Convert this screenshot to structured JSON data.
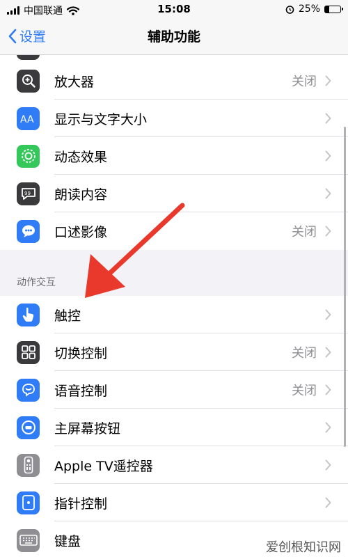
{
  "status_bar": {
    "carrier": "中国联通",
    "time": "15:08",
    "battery_percent": "25%",
    "battery_level": 0.25
  },
  "nav": {
    "back_label": "设置",
    "title": "辅助功能"
  },
  "vision_items": [
    {
      "label": "放大器",
      "value": "关闭",
      "icon": "magnifier-icon",
      "color": "#3a3a3c"
    },
    {
      "label": "显示与文字大小",
      "value": "",
      "icon": "text-size-icon",
      "color": "#2f7cf6"
    },
    {
      "label": "动态效果",
      "value": "",
      "icon": "motion-icon",
      "color": "#34c759"
    },
    {
      "label": "朗读内容",
      "value": "",
      "icon": "speech-bubble-icon",
      "color": "#3a3a3c"
    },
    {
      "label": "口述影像",
      "value": "关闭",
      "icon": "audio-description-icon",
      "color": "#2f7cf6"
    }
  ],
  "section_header": "动作交互",
  "interaction_items": [
    {
      "label": "触控",
      "value": "",
      "icon": "touch-hand-icon",
      "color": "#2f7cf6"
    },
    {
      "label": "切换控制",
      "value": "关闭",
      "icon": "switch-grid-icon",
      "color": "#3a3a3c"
    },
    {
      "label": "语音控制",
      "value": "关闭",
      "icon": "voice-control-icon",
      "color": "#2f7cf6"
    },
    {
      "label": "主屏幕按钮",
      "value": "",
      "icon": "home-button-icon",
      "color": "#2f7cf6"
    },
    {
      "label": "Apple TV遥控器",
      "value": "",
      "icon": "tv-remote-icon",
      "color": "#8e8e93"
    },
    {
      "label": "指针控制",
      "value": "",
      "icon": "pointer-icon",
      "color": "#2f7cf6"
    },
    {
      "label": "键盘",
      "value": "",
      "icon": "keyboard-icon",
      "color": "#8e8e93"
    }
  ],
  "watermark": "爱创根知识网",
  "annotation_arrow_color": "#e8392c"
}
